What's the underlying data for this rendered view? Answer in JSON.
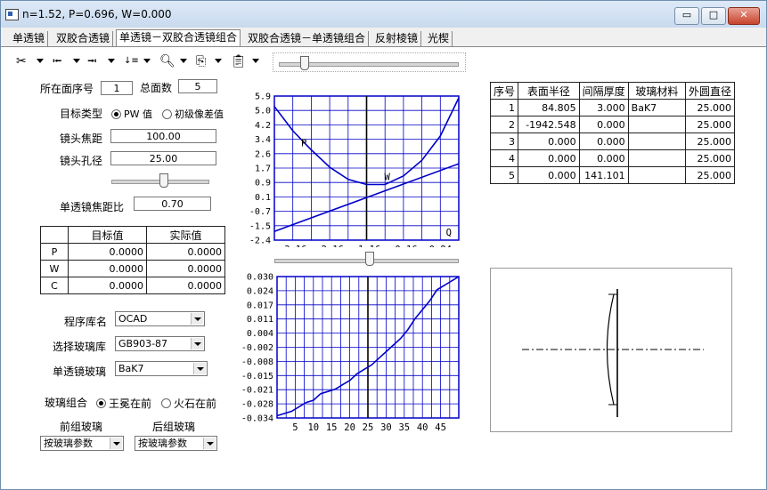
{
  "window": {
    "title": "n=1.52,    P=0.696,    W=0.000",
    "minimize_label": "▭",
    "maximize_label": "□",
    "close_label": "✕"
  },
  "tabs": [
    {
      "label": "单透镜"
    },
    {
      "label": "双胶合透镜"
    },
    {
      "label": "单透镜－双胶合透镜组合",
      "active": true
    },
    {
      "label": "双胶合透镜－单透镜组合"
    },
    {
      "label": "反射棱镜"
    },
    {
      "label": "光楔"
    }
  ],
  "toolbar": {
    "icons": [
      "scissors-icon",
      "align-left-icon",
      "align-right-icon",
      "sort-icon",
      "zoom-icon",
      "copy-icon",
      "paste-icon"
    ]
  },
  "left": {
    "surface_index_label": "所在面序号",
    "surface_index_value": "1",
    "total_surfaces_label": "总面数",
    "total_surfaces_value": "5",
    "target_type_label": "目标类型",
    "target_pw_label": "PW 值",
    "target_aberration_label": "初级像差值",
    "focal_label": "镜头焦距",
    "focal_value": "100.00",
    "aperture_label": "镜头孔径",
    "aperture_value": "25.00",
    "ratio_label": "单透镜焦距比",
    "ratio_value": "0.70",
    "pwc_table": {
      "headers": [
        "",
        "目标值",
        "实际值"
      ],
      "rows": [
        {
          "name": "P",
          "target": "0.0000",
          "actual": "0.0000"
        },
        {
          "name": "W",
          "target": "0.0000",
          "actual": "0.0000"
        },
        {
          "name": "C",
          "target": "0.0000",
          "actual": "0.0000"
        }
      ]
    },
    "library_label": "程序库名",
    "library_value": "OCAD",
    "glass_lib_label": "选择玻璃库",
    "glass_lib_value": "GB903-87",
    "single_glass_label": "单透镜玻璃",
    "single_glass_value": "BaK7",
    "combo_label": "玻璃组合",
    "combo_crown_label": "王冕在前",
    "combo_flint_label": "火石在前",
    "front_glass_label": "前组玻璃",
    "front_glass_value": "按玻璃参数",
    "rear_glass_label": "后组玻璃",
    "rear_glass_value": "按玻璃参数"
  },
  "surface_table": {
    "headers": [
      "序号",
      "表面半径",
      "间隔厚度",
      "玻璃材料",
      "外圆直径"
    ],
    "rows": [
      {
        "idx": "1",
        "radius": "84.805",
        "thickness": "3.000",
        "material": "BaK7",
        "diameter": "25.000"
      },
      {
        "idx": "2",
        "radius": "-1942.548",
        "thickness": "0.000",
        "material": "",
        "diameter": "25.000"
      },
      {
        "idx": "3",
        "radius": "0.000",
        "thickness": "0.000",
        "material": "",
        "diameter": "25.000"
      },
      {
        "idx": "4",
        "radius": "0.000",
        "thickness": "0.000",
        "material": "",
        "diameter": "25.000"
      },
      {
        "idx": "5",
        "radius": "0.000",
        "thickness": "141.101",
        "material": "",
        "diameter": "25.000"
      }
    ]
  },
  "colors": {
    "chart_line": "#0000c8",
    "grid": "#0000c8",
    "axis": "#000000"
  },
  "chart_data": [
    {
      "type": "line",
      "x_ticks": [
        "-3.16",
        "-2.16",
        "-1.16",
        "-0.16",
        "0.84"
      ],
      "y_ticks": [
        "5.9",
        "5.0",
        "4.2",
        "3.4",
        "2.6",
        "1.7",
        "0.9",
        "0.1",
        "-0.7",
        "-1.5",
        "-2.4"
      ],
      "xlim": [
        -3.66,
        1.34
      ],
      "ylim": [
        -2.4,
        5.9
      ],
      "vline": -1.16,
      "annotations": [
        {
          "text": "P",
          "x": -2.86,
          "y": 3.0
        },
        {
          "text": "W",
          "x": -0.6,
          "y": 1.05
        },
        {
          "text": "Q",
          "x": 1.07,
          "y": -2.15
        }
      ],
      "series": [
        {
          "name": "P",
          "x": [
            -3.66,
            -3.16,
            -2.66,
            -2.16,
            -1.66,
            -1.16,
            -0.66,
            -0.16,
            0.34,
            0.84,
            1.34
          ],
          "y": [
            5.3,
            3.9,
            2.8,
            1.8,
            1.1,
            0.8,
            0.8,
            1.3,
            2.2,
            3.6,
            5.8
          ]
        },
        {
          "name": "W",
          "x": [
            -3.66,
            1.34
          ],
          "y": [
            -1.9,
            2.0
          ]
        }
      ]
    },
    {
      "type": "line",
      "x_ticks": [
        "5",
        "10",
        "15",
        "20",
        "25",
        "30",
        "35",
        "40",
        "45"
      ],
      "y_ticks": [
        "0.030",
        "0.024",
        "0.017",
        "0.011",
        "0.004",
        "-0.002",
        "-0.008",
        "-0.015",
        "-0.021",
        "-0.028",
        "-0.034"
      ],
      "xlim": [
        0,
        50
      ],
      "ylim": [
        -0.034,
        0.03
      ],
      "vline": 25,
      "series": [
        {
          "x": [
            0,
            2,
            4,
            6,
            8,
            10,
            12,
            14,
            16,
            18,
            20,
            22,
            24,
            26,
            28,
            30,
            32,
            34,
            36,
            38,
            40,
            42,
            44,
            46,
            48,
            50
          ],
          "y": [
            -0.033,
            -0.032,
            -0.031,
            -0.029,
            -0.027,
            -0.026,
            -0.023,
            -0.022,
            -0.021,
            -0.019,
            -0.017,
            -0.014,
            -0.012,
            -0.01,
            -0.007,
            -0.004,
            -0.001,
            0.002,
            0.006,
            0.011,
            0.015,
            0.019,
            0.024,
            0.026,
            0.028,
            0.03
          ]
        }
      ]
    }
  ]
}
